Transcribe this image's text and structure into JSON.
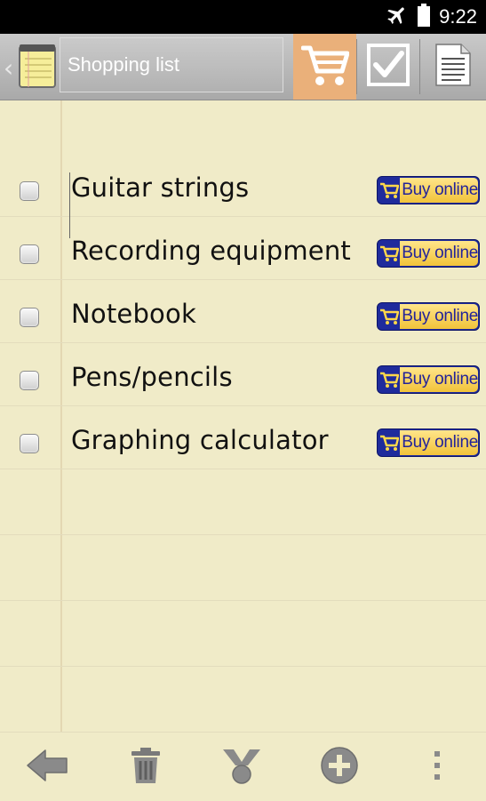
{
  "status_bar": {
    "time": "9:22",
    "icons": [
      "airplane-icon",
      "battery-icon"
    ]
  },
  "action_bar": {
    "title": "Shopping list",
    "icons": [
      "back-chevron-icon",
      "notepad-icon",
      "shopping-cart-icon",
      "checkbox-checked-icon",
      "document-icon"
    ],
    "active_tab_color": "#eab07a"
  },
  "list": {
    "items": [
      {
        "label": "Guitar strings",
        "checked": false,
        "buy_label": "Buy online"
      },
      {
        "label": "Recording equipment",
        "checked": false,
        "buy_label": "Buy online"
      },
      {
        "label": "Notebook",
        "checked": false,
        "buy_label": "Buy online"
      },
      {
        "label": "Pens/pencils",
        "checked": false,
        "buy_label": "Buy online"
      },
      {
        "label": "Graphing calculator",
        "checked": false,
        "buy_label": "Buy online"
      }
    ]
  },
  "bottom_bar": {
    "icons": [
      "back-arrow-icon",
      "trash-icon",
      "share-icon",
      "add-circle-icon",
      "overflow-menu-icon"
    ]
  },
  "colors": {
    "paper": "#f0ebc8",
    "buy_blue": "#1f2b9c",
    "buy_yellow": "#f1c33a"
  }
}
